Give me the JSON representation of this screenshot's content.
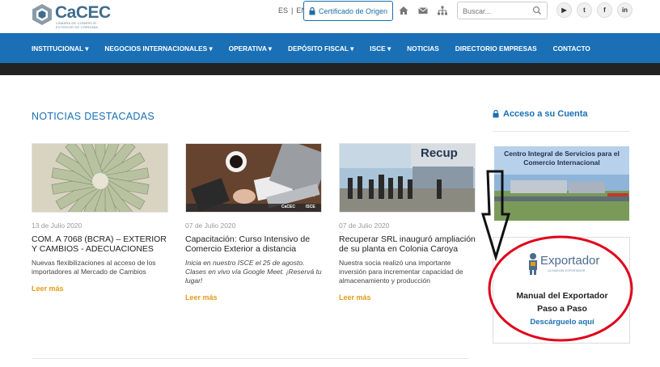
{
  "header": {
    "logo_text": "CaCEC",
    "logo_sub": "CÁMARA DE COMERCIO EXTERIOR DE CÓRDOBA",
    "lang_es": "ES",
    "lang_sep": "|",
    "lang_en": "EN",
    "cert_button": "Certificado de Origen",
    "search_placeholder": "Buscar...",
    "icons": [
      "home-icon",
      "mail-icon",
      "sitemap-icon"
    ],
    "socials": [
      "youtube",
      "twitter",
      "facebook",
      "linkedin"
    ],
    "social_labels": [
      "▶",
      "t",
      "f",
      "in"
    ]
  },
  "nav": {
    "items": [
      "INSTITUCIONAL ▾",
      "NEGOCIOS INTERNACIONALES ▾",
      "OPERATIVA ▾",
      "DEPÓSITO FISCAL ▾",
      "ISCE ▾",
      "NOTICIAS",
      "DIRECTORIO EMPRESAS",
      "CONTACTO"
    ]
  },
  "main": {
    "section_title": "NOTICIAS DESTACADAS",
    "cards": [
      {
        "date": "13 de Julio 2020",
        "title": "COM. A 7068 (BCRA) – EXTERIOR Y CAMBIOS - ADECUACIONES",
        "body": " Nuevas flexibilizaciones al acceso de los importadores al Mercado de Cambios",
        "more": "Leer más"
      },
      {
        "date": "07 de Julio 2020",
        "title": "Capacitación: Curso Intensivo de Comercio Exterior a distancia",
        "body": "Inicia en nuestro ISCE el 25 de agosto.  Clases en vivo vía Google Meet. ¡Reservá tu lugar!",
        "more": "Leer más",
        "image_brand_1": "CaCEC",
        "image_brand_2": "ISCE"
      },
      {
        "date": "07 de Julio 2020",
        "title": "Recuperar SRL inauguró ampliación de su planta en Colonia Caroya",
        "body": "Nuestra socia realizó una importante inversión para incrementar capacidad de almacenamiento y producción",
        "more": "Leer más",
        "image_sign": "Recup"
      }
    ]
  },
  "sidebar": {
    "account_title": "Acceso a su Cuenta",
    "banner_text": "Centro Integral de Servicios para el Comercio Internacional",
    "exporter_logo": "Exportador",
    "exporter_logo_sub": "LA GUÍA DEL EXPORTADOR",
    "exporter_title_1": "Manual del Exportador",
    "exporter_title_2": "Paso a Paso",
    "exporter_link": "Descárguelo aquí"
  },
  "colors": {
    "brand_blue": "#1a6fb5",
    "accent_orange": "#e59b1a",
    "annotation_red": "#e0001a"
  }
}
